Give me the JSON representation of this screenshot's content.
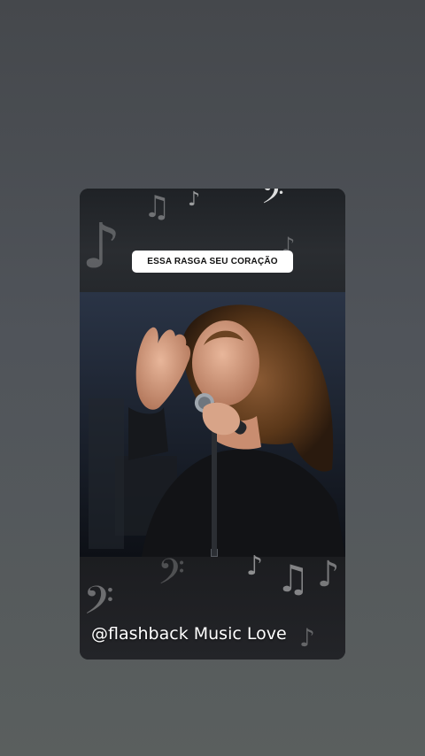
{
  "story": {
    "caption": "ESSA RASGA SEU CORAÇÃO",
    "watermark": "@flashback Music Love"
  },
  "icons": {
    "note": "♪",
    "double_note": "♫",
    "bass_clef": "𝄢",
    "treble_clef": "𝄞"
  },
  "colors": {
    "page_background": "#4b4f53",
    "card_background": "#15171a",
    "caption_background": "#ffffff",
    "caption_text": "#111111",
    "watermark_text": "#ffffff"
  }
}
